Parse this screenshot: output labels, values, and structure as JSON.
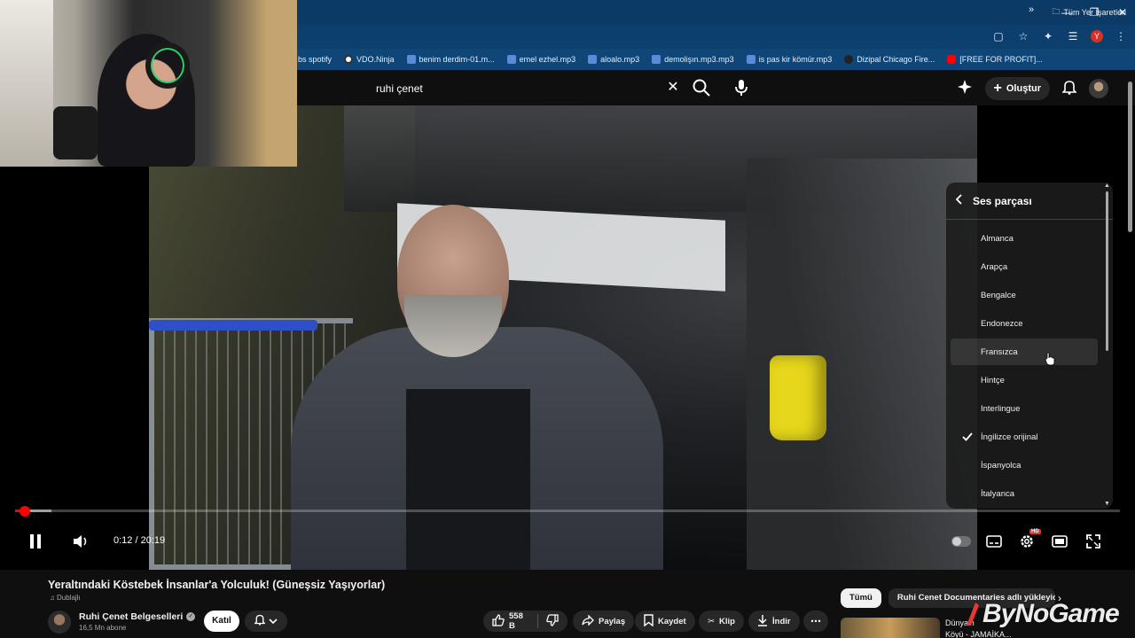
{
  "browser": {
    "bookmarks": [
      {
        "label": "bs spotify",
        "icon": "none"
      },
      {
        "label": "VDO.Ninja",
        "icon": "wheel"
      },
      {
        "label": "benim derdim-01.m...",
        "icon": "blue"
      },
      {
        "label": "emel ezhel.mp3",
        "icon": "blue"
      },
      {
        "label": "aloalo.mp3",
        "icon": "blue"
      },
      {
        "label": "demolişın.mp3.mp3",
        "icon": "blue"
      },
      {
        "label": "is pas kir kömür.mp3",
        "icon": "blue"
      },
      {
        "label": "Dizipal Chicago Fire...",
        "icon": "dark"
      },
      {
        "label": "[FREE FOR PROFIT]...",
        "icon": "red"
      }
    ],
    "bookmarks_more": "»",
    "all_bookmarks": "Tüm Yer İşaretleri",
    "profile_initial": "Y"
  },
  "header": {
    "search_value": "ruhi çenet",
    "create_label": "Oluştur"
  },
  "player": {
    "current_time": "0:12",
    "duration": "20:19",
    "time_display": "0:12 / 20:19",
    "progress_fraction": 0.0098,
    "buffer_fraction": 0.033,
    "hd_badge": "HD"
  },
  "audio_menu": {
    "title": "Ses parçası",
    "items": [
      {
        "label": "Almanca",
        "selected": false
      },
      {
        "label": "Arapça",
        "selected": false
      },
      {
        "label": "Bengalce",
        "selected": false
      },
      {
        "label": "Endonezce",
        "selected": false
      },
      {
        "label": "Fransızca",
        "selected": false,
        "hover": true
      },
      {
        "label": "Hintçe",
        "selected": false
      },
      {
        "label": "Interlingue",
        "selected": false
      },
      {
        "label": "İngilizce orijinal",
        "selected": true
      },
      {
        "label": "İspanyolca",
        "selected": false
      },
      {
        "label": "İtalyanca",
        "selected": false
      }
    ]
  },
  "video": {
    "title": "Yeraltındaki Köstebek İnsanlar'a Yolculuk! (Güneşsiz Yaşıyorlar)",
    "dubbed_label": "Dublajlı",
    "channel_name": "Ruhi Çenet Belgeselleri",
    "subscribers": "16,5 Mn abone",
    "join_label": "Katıl",
    "like_count": "558 B",
    "share_label": "Paylaş",
    "save_label": "Kaydet",
    "clip_label": "Klip",
    "download_label": "İndir"
  },
  "sidebar": {
    "chips": [
      "Tümü",
      "Ruhi Cenet Documentaries adlı yükleyicid"
    ],
    "rec_title_line1": "Dünya'n",
    "rec_title_line2": "Köyü - JAMAİKA..."
  },
  "watermark": {
    "text": "ByNoGame"
  }
}
